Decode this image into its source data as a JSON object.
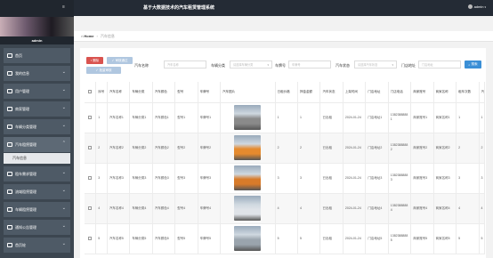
{
  "app": {
    "title": "基于大数据技术的汽车租赁管理系统",
    "user": "admin"
  },
  "sidebar": {
    "admin_name": "admin",
    "items": [
      {
        "label": "首页",
        "icon": "home-icon"
      },
      {
        "label": "我的信息",
        "icon": "user-icon"
      },
      {
        "label": "用户管理",
        "icon": "users-icon"
      },
      {
        "label": "商家管理",
        "icon": "shop-icon"
      },
      {
        "label": "车辆分类管理",
        "icon": "category-icon"
      },
      {
        "label": "汽车租赁管理",
        "icon": "car-icon"
      },
      {
        "label": "汽车信息",
        "icon": ""
      },
      {
        "label": "租车需求管理",
        "icon": "request-icon"
      },
      {
        "label": "流域租赁管理",
        "icon": "lease-icon"
      },
      {
        "label": "车辆租赁管理",
        "icon": "rent-icon"
      },
      {
        "label": "通知公告管理",
        "icon": "notice-icon"
      },
      {
        "label": "首页轮",
        "icon": "carousel-icon"
      }
    ]
  },
  "breadcrumb": {
    "home": "Home",
    "current": "汽车信息"
  },
  "toolbar": {
    "delete": "删除",
    "audit": "审核通过",
    "batch": "批量审核"
  },
  "search": {
    "labels": [
      "汽车名称",
      "车辆分类",
      "车牌号",
      "汽车状态",
      "门店地址"
    ],
    "placeholders": [
      "汽车名称",
      "请选择车辆分类",
      "车牌号",
      "请选择汽车状态",
      "门店地址"
    ],
    "button": "搜索"
  },
  "table": {
    "headers": [
      "序号",
      "汽车名称",
      "车辆分类",
      "汽车颜色",
      "型号",
      "车牌号",
      "汽车图片",
      "日租价格",
      "押金金额",
      "汽车状态",
      "上架时间",
      "门店地址",
      "门店电话",
      "商家账号",
      "商家名称",
      "租车次数",
      "汽"
    ],
    "rows": [
      [
        "1",
        "汽车名称1",
        "车辆分类1",
        "汽车颜色1",
        "型号1",
        "车牌号1",
        "",
        "1",
        "1",
        "已出租",
        "2024-01-24",
        "门店地址1",
        "13823888881",
        "商家账号1",
        "商家名称1",
        "1",
        "1"
      ],
      [
        "2",
        "汽车名称2",
        "车辆分类2",
        "汽车颜色2",
        "型号2",
        "车牌号2",
        "",
        "2",
        "2",
        "已出租",
        "2024-01-24",
        "门店地址2",
        "13823888882",
        "商家账号2",
        "商家名称2",
        "2",
        "2"
      ],
      [
        "3",
        "汽车名称3",
        "车辆分类3",
        "汽车颜色3",
        "型号3",
        "车牌号3",
        "",
        "3",
        "3",
        "已出租",
        "2024-01-24",
        "门店地址3",
        "13823888883",
        "商家账号3",
        "商家名称3",
        "3",
        "3"
      ],
      [
        "4",
        "汽车名称4",
        "车辆分类4",
        "汽车颜色4",
        "型号4",
        "车牌号4",
        "",
        "4",
        "4",
        "已出租",
        "2024-01-24",
        "门店地址4",
        "13823888884",
        "商家账号4",
        "商家名称4",
        "4",
        "4"
      ],
      [
        "5",
        "汽车名称5",
        "车辆分类5",
        "汽车颜色5",
        "型号5",
        "车牌号5",
        "",
        "5",
        "5",
        "已出租",
        "2024-01-24",
        "门店地址5",
        "13823888885",
        "商家账号5",
        "商家名称5",
        "5",
        "5"
      ]
    ],
    "car_colors": [
      "#8a8a8a",
      "#e58a2e",
      "#d87b2a",
      "#dfe3e8",
      "#9aa4ad"
    ]
  }
}
